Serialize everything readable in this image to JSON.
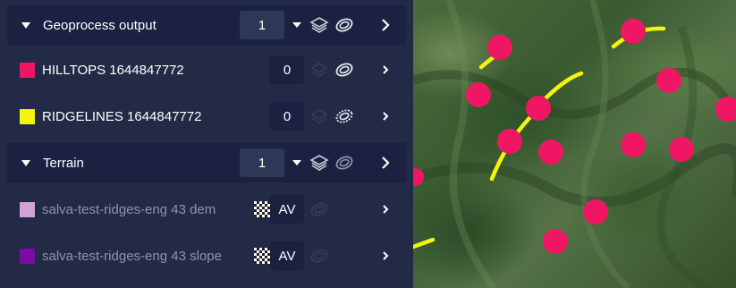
{
  "layers_panel": {
    "groups": [
      {
        "name": "Geoprocess output",
        "count": "1",
        "layers": [
          {
            "name": "HILLTOPS 1644847772",
            "value": "0",
            "color": "#ef1764"
          },
          {
            "name": "RIDGELINES 1644847772",
            "value": "0",
            "color": "#f4f40c"
          }
        ]
      },
      {
        "name": "Terrain",
        "count": "1",
        "layers": [
          {
            "name": "salva-test-ridges-eng 43 dem",
            "value": "AV",
            "color": "#cfa3d5"
          },
          {
            "name": "salva-test-ridges-eng 43 slope",
            "value": "AV",
            "color": "#7b0aa6"
          }
        ]
      }
    ]
  },
  "icons": {
    "group_row": [
      "chevron-down-icon",
      "caret-down-icon",
      "layers-stack-icon",
      "visibility-toggle-icon",
      "chevron-right-icon"
    ],
    "layer_row": [
      "opacity-pattern-icon",
      "visibility-toggle-icon",
      "chevron-right-icon"
    ]
  },
  "map": {
    "hilltop_color": "#ef1764",
    "ridgeline_color": "#f4f40c"
  }
}
